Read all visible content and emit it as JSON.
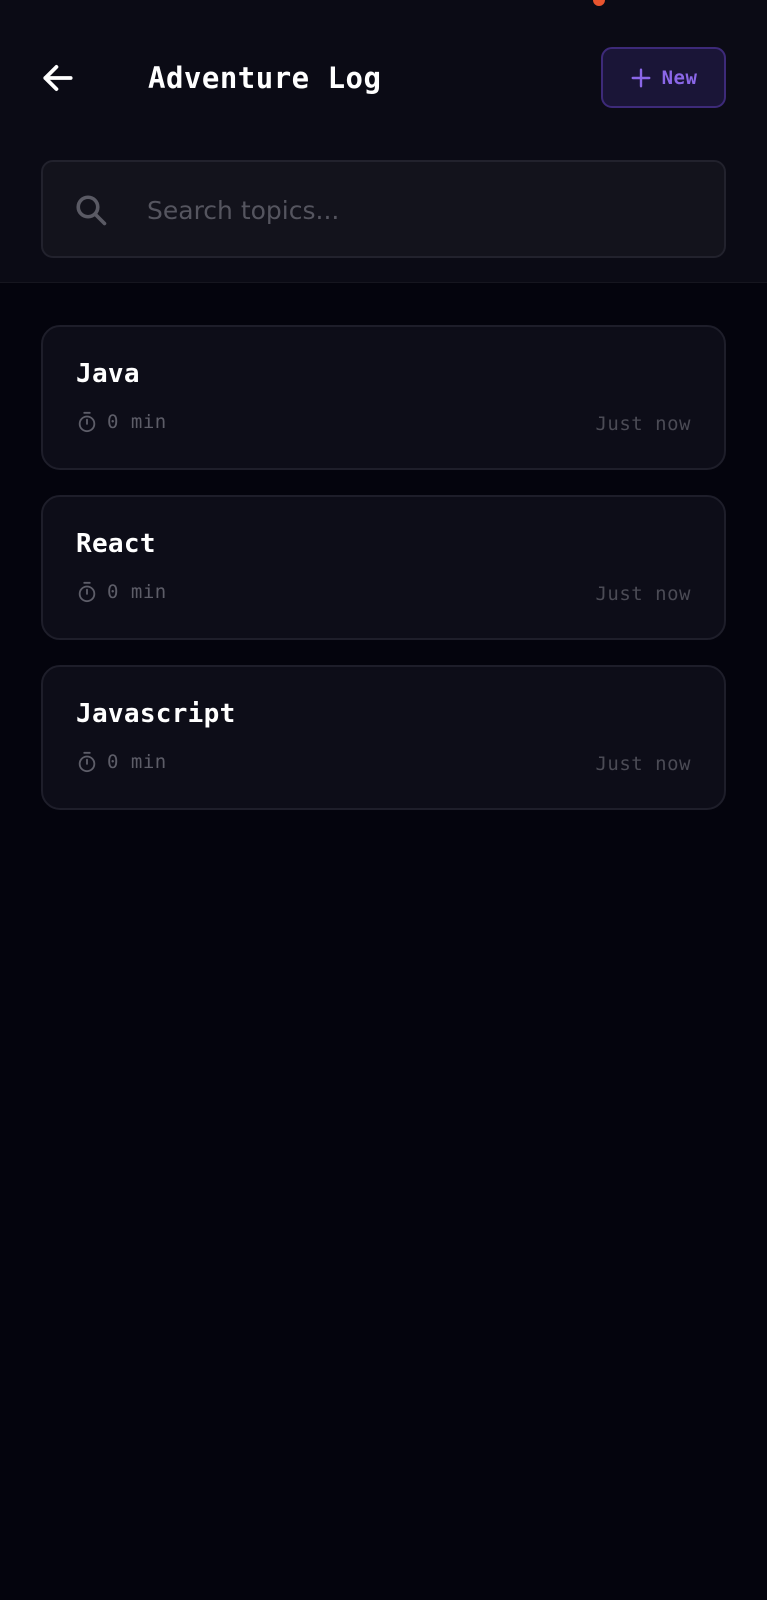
{
  "header": {
    "title": "Adventure Log",
    "back_icon": "arrow-left-icon",
    "new_button": {
      "label": "New",
      "icon": "plus-icon"
    }
  },
  "search": {
    "placeholder": "Search topics...",
    "value": "",
    "icon": "search-icon"
  },
  "topics": [
    {
      "name": "Java",
      "duration": "0 min",
      "updated": "Just now"
    },
    {
      "name": "React",
      "duration": "0 min",
      "updated": "Just now"
    },
    {
      "name": "Javascript",
      "duration": "0 min",
      "updated": "Just now"
    }
  ],
  "colors": {
    "background": "#04040d",
    "header_background": "#0b0b15",
    "accent": "#8b67e8",
    "accent_border": "#3d2a79",
    "card_background": "#0d0d18",
    "card_border": "#1e1e2a",
    "muted_text": "#5d5d68",
    "notification_dot": "#e8542e"
  }
}
